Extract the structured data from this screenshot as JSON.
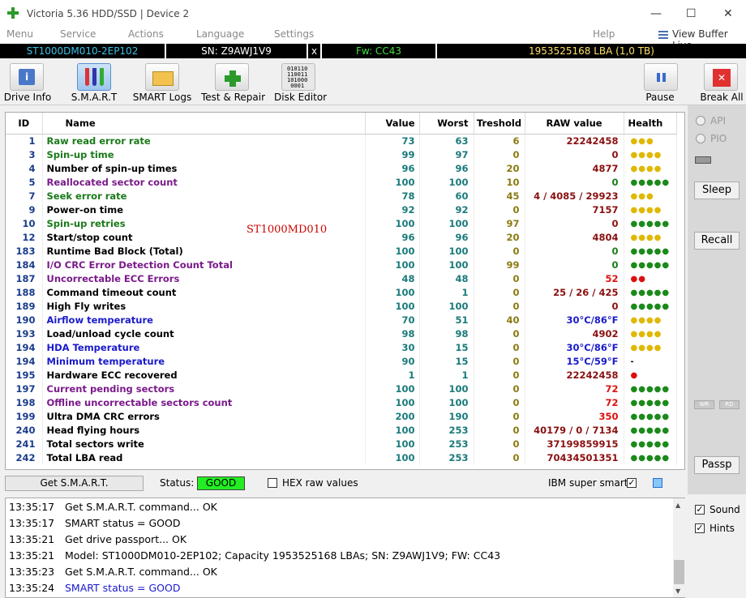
{
  "window": {
    "title": "Victoria 5.36 HDD/SSD | Device 2",
    "min": "—",
    "max": "☐",
    "close": "✕"
  },
  "menu": {
    "items": [
      "Menu",
      "Service",
      "Actions",
      "Language",
      "Settings",
      "Help"
    ],
    "view_buffer": "View Buffer Live"
  },
  "infobar": {
    "model": "ST1000DM010-2EP102",
    "sn": "SN: Z9AWJ1V9",
    "x": "x",
    "fw": "Fw: CC43",
    "lba": "1953525168 LBA (1,0 TB)",
    "colors": {
      "model": "#3cc3e6",
      "sn": "#ffffff",
      "fw": "#44dd44",
      "lba": "#ffe066"
    }
  },
  "toolbar": {
    "buttons": [
      {
        "label": "Drive Info",
        "icon": "info-icon"
      },
      {
        "label": "S.M.A.R.T",
        "icon": "test-tubes-icon"
      },
      {
        "label": "SMART Logs",
        "icon": "folder-icon"
      },
      {
        "label": "Test & Repair",
        "icon": "first-aid-icon"
      },
      {
        "label": "Disk Editor",
        "icon": "binary-disk-icon"
      }
    ],
    "pause": "Pause",
    "break_all": "Break All"
  },
  "table": {
    "headers": [
      "ID",
      "Name",
      "Value",
      "Worst",
      "Treshold",
      "RAW value",
      "Health"
    ],
    "rows": [
      {
        "id": "1",
        "name": "Raw read error rate",
        "color": "#1a7a1a",
        "value": "73",
        "worst": "63",
        "thr": "6",
        "raw": "22242458",
        "raw_color": "#8a1010",
        "health": "●●●",
        "hcolor": "#e0b800"
      },
      {
        "id": "3",
        "name": "Spin-up time",
        "color": "#1a7a1a",
        "value": "99",
        "worst": "97",
        "thr": "0",
        "raw": "0",
        "raw_color": "#8a1010",
        "health": "●●●●",
        "hcolor": "#e0b800"
      },
      {
        "id": "4",
        "name": "Number of spin-up times",
        "color": "#000000",
        "value": "96",
        "worst": "96",
        "thr": "20",
        "raw": "4877",
        "raw_color": "#8a1010",
        "health": "●●●●",
        "hcolor": "#e0b800"
      },
      {
        "id": "5",
        "name": "Reallocated sector count",
        "color": "#7a1a8a",
        "value": "100",
        "worst": "100",
        "thr": "10",
        "raw": "0",
        "raw_color": "#1a7a1a",
        "health": "●●●●●",
        "hcolor": "#1a8a1a"
      },
      {
        "id": "7",
        "name": "Seek error rate",
        "color": "#1a7a1a",
        "value": "78",
        "worst": "60",
        "thr": "45",
        "raw": "4 / 4085 / 29923",
        "raw_color": "#8a1010",
        "health": "●●●",
        "hcolor": "#e0b800"
      },
      {
        "id": "9",
        "name": "Power-on time",
        "color": "#000000",
        "value": "92",
        "worst": "92",
        "thr": "0",
        "raw": "7157",
        "raw_color": "#8a1010",
        "health": "●●●●",
        "hcolor": "#e0b800"
      },
      {
        "id": "10",
        "name": "Spin-up retries",
        "color": "#1a7a1a",
        "value": "100",
        "worst": "100",
        "thr": "97",
        "raw": "0",
        "raw_color": "#8a1010",
        "health": "●●●●●",
        "hcolor": "#1a8a1a"
      },
      {
        "id": "12",
        "name": "Start/stop count",
        "color": "#000000",
        "value": "96",
        "worst": "96",
        "thr": "20",
        "raw": "4804",
        "raw_color": "#8a1010",
        "health": "●●●●",
        "hcolor": "#e0b800"
      },
      {
        "id": "183",
        "name": "Runtime Bad Block (Total)",
        "color": "#000000",
        "value": "100",
        "worst": "100",
        "thr": "0",
        "raw": "0",
        "raw_color": "#1a7a1a",
        "health": "●●●●●",
        "hcolor": "#1a8a1a"
      },
      {
        "id": "184",
        "name": "I/O CRC Error Detection Count Total",
        "color": "#7a1a8a",
        "value": "100",
        "worst": "100",
        "thr": "99",
        "raw": "0",
        "raw_color": "#1a7a1a",
        "health": "●●●●●",
        "hcolor": "#1a8a1a"
      },
      {
        "id": "187",
        "name": "Uncorrectable ECC Errors",
        "color": "#7a1a8a",
        "value": "48",
        "worst": "48",
        "thr": "0",
        "raw": "52",
        "raw_color": "#dd1010",
        "health": "●●",
        "hcolor": "#dd1010"
      },
      {
        "id": "188",
        "name": "Command timeout count",
        "color": "#000000",
        "value": "100",
        "worst": "1",
        "thr": "0",
        "raw": "25 / 26 / 425",
        "raw_color": "#8a1010",
        "health": "●●●●●",
        "hcolor": "#1a8a1a"
      },
      {
        "id": "189",
        "name": "High Fly writes",
        "color": "#000000",
        "value": "100",
        "worst": "100",
        "thr": "0",
        "raw": "0",
        "raw_color": "#8a1010",
        "health": "●●●●●",
        "hcolor": "#1a8a1a"
      },
      {
        "id": "190",
        "name": "Airflow temperature",
        "color": "#1a1acc",
        "value": "70",
        "worst": "51",
        "thr": "40",
        "raw": "30°C/86°F",
        "raw_color": "#1a1acc",
        "health": "●●●●",
        "hcolor": "#e0b800"
      },
      {
        "id": "193",
        "name": "Load/unload cycle count",
        "color": "#000000",
        "value": "98",
        "worst": "98",
        "thr": "0",
        "raw": "4902",
        "raw_color": "#8a1010",
        "health": "●●●●",
        "hcolor": "#e0b800"
      },
      {
        "id": "194",
        "name": "HDA Temperature",
        "color": "#1a1acc",
        "value": "30",
        "worst": "15",
        "thr": "0",
        "raw": "30°C/86°F",
        "raw_color": "#1a1acc",
        "health": "●●●●",
        "hcolor": "#e0b800"
      },
      {
        "id": "194",
        "name": "Minimum temperature",
        "color": "#1a1acc",
        "value": "90",
        "worst": "15",
        "thr": "0",
        "raw": "15°C/59°F",
        "raw_color": "#1a1acc",
        "health": "-",
        "hcolor": "#000000"
      },
      {
        "id": "195",
        "name": "Hardware ECC recovered",
        "color": "#000000",
        "value": "1",
        "worst": "1",
        "thr": "0",
        "raw": "22242458",
        "raw_color": "#8a1010",
        "health": "●",
        "hcolor": "#dd1010"
      },
      {
        "id": "197",
        "name": "Current pending sectors",
        "color": "#7a1a8a",
        "value": "100",
        "worst": "100",
        "thr": "0",
        "raw": "72",
        "raw_color": "#dd1010",
        "health": "●●●●●",
        "hcolor": "#1a8a1a"
      },
      {
        "id": "198",
        "name": "Offline uncorrectable sectors count",
        "color": "#7a1a8a",
        "value": "100",
        "worst": "100",
        "thr": "0",
        "raw": "72",
        "raw_color": "#dd1010",
        "health": "●●●●●",
        "hcolor": "#1a8a1a"
      },
      {
        "id": "199",
        "name": "Ultra DMA CRC errors",
        "color": "#000000",
        "value": "200",
        "worst": "190",
        "thr": "0",
        "raw": "350",
        "raw_color": "#dd1010",
        "health": "●●●●●",
        "hcolor": "#1a8a1a"
      },
      {
        "id": "240",
        "name": "Head flying hours",
        "color": "#000000",
        "value": "100",
        "worst": "253",
        "thr": "0",
        "raw": "40179 / 0 / 7134",
        "raw_color": "#8a1010",
        "health": "●●●●●",
        "hcolor": "#1a8a1a"
      },
      {
        "id": "241",
        "name": "Total sectors write",
        "color": "#000000",
        "value": "100",
        "worst": "253",
        "thr": "0",
        "raw": "37199859915",
        "raw_color": "#8a1010",
        "health": "●●●●●",
        "hcolor": "#1a8a1a"
      },
      {
        "id": "242",
        "name": "Total LBA read",
        "color": "#000000",
        "value": "100",
        "worst": "253",
        "thr": "0",
        "raw": "70434501351",
        "raw_color": "#8a1010",
        "health": "●●●●●",
        "hcolor": "#1a8a1a"
      }
    ],
    "overlay": "ST1000MD010"
  },
  "status": {
    "get_smart": "Get S.M.A.R.T.",
    "status_label": "Status:",
    "status_value": "GOOD",
    "hex_label": "HEX raw values",
    "ibm_label": "IBM super smart:",
    "ibm_check": "✓"
  },
  "side": {
    "api": "API",
    "pio": "PIO",
    "sleep": "Sleep",
    "recall": "Recall",
    "wr": "WR",
    "rd": "RD",
    "passp": "Passp",
    "sound": "Sound",
    "hints": "Hints",
    "check": "✓"
  },
  "log": [
    {
      "time": "13:35:17",
      "msg": "Get S.M.A.R.T. command... OK",
      "color": "#000000"
    },
    {
      "time": "13:35:17",
      "msg": "SMART status = GOOD",
      "color": "#000000"
    },
    {
      "time": "13:35:21",
      "msg": "Get drive passport... OK",
      "color": "#000000"
    },
    {
      "time": "13:35:21",
      "msg": "Model: ST1000DM010-2EP102; Capacity 1953525168 LBAs; SN: Z9AWJ1V9; FW: CC43",
      "color": "#000000"
    },
    {
      "time": "13:35:23",
      "msg": "Get S.M.A.R.T. command... OK",
      "color": "#000000"
    },
    {
      "time": "13:35:24",
      "msg": "SMART status = GOOD",
      "color": "#1a1acc"
    }
  ]
}
